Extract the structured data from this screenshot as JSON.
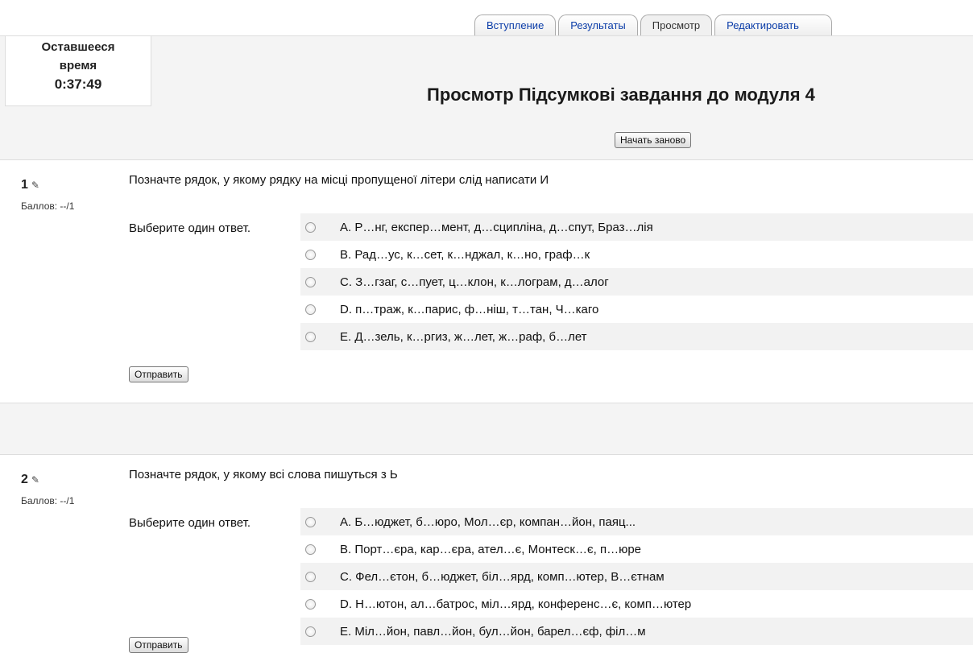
{
  "tabs": [
    "Вступление",
    "Результаты",
    "Просмотр",
    "Редактировать"
  ],
  "timer": {
    "label_line1": "Оставшееся",
    "label_line2": "время",
    "value": "0:37:49"
  },
  "page_title": "Просмотр Підсумкові завдання до модуля 4",
  "restart_label": "Начать заново",
  "questions": [
    {
      "number": "1",
      "score": "Баллов: --/1",
      "text": "Позначте рядок, у якому рядку на місці пропущеної літери слід написати И",
      "choose_label": "Выберите один ответ.",
      "answers": [
        "A. Р…нг, експер…мент, д…сципліна, д…спут, Браз…лія",
        "B. Рад…ус, к…сет, к…нджал, к…но, граф…к",
        "C. З…гзаг, с…пует, ц…клон, к…лограм, д…алог",
        "D. п…траж, к…парис, ф…ніш, т…тан, Ч…каго",
        "E. Д…зель, к…ргиз, ж…лет, ж…раф, б…лет"
      ],
      "submit_label": "Отправить"
    },
    {
      "number": "2",
      "score": "Баллов: --/1",
      "text": "Позначте рядок, у якому всі слова пишуться з Ь",
      "choose_label": "Выберите один ответ.",
      "answers": [
        "A. Б…юджет, б…юро, Мол…єр, компан…йон, паяц...",
        "B. Порт…єра, кар…єра, ател…є, Монтеск…є, п…юре",
        "C. Фел…єтон, б…юджет, біл…ярд, комп…ютер, В…єтнам",
        "D. Н…ютон, ал…батрос, міл…ярд, конференс…є, комп…ютер",
        "E. Міл…йон, павл…йон, бул…йон, барел…єф, філ…м"
      ],
      "submit_label": "Отправить"
    }
  ]
}
